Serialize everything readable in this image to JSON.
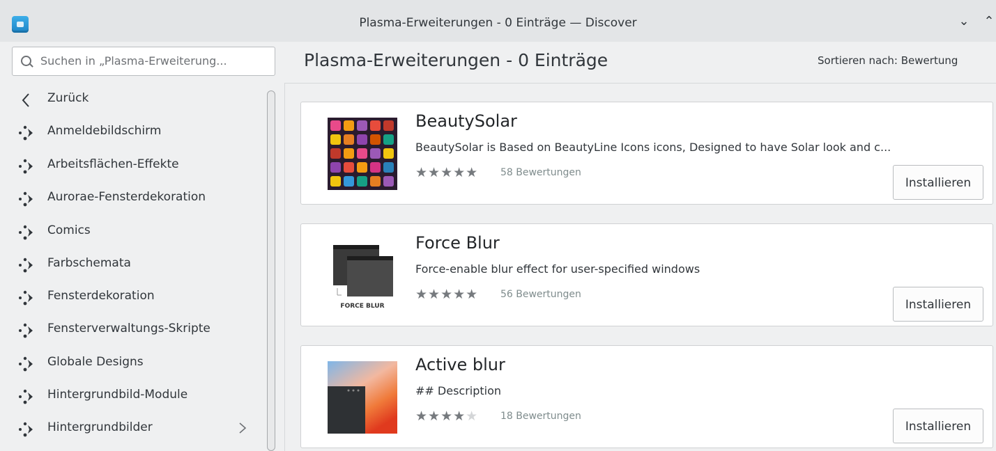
{
  "window": {
    "title": "Plasma-Erweiterungen - 0 Einträge — Discover",
    "min_icon": "chevron-down-icon",
    "max_icon": "chevron-up-icon"
  },
  "search": {
    "placeholder": "Suchen in „Plasma-Erweiterung..."
  },
  "header": {
    "title": "Plasma-Erweiterungen - 0 Einträge",
    "sort_label": "Sortieren nach: Bewertung"
  },
  "sidebar": {
    "items": [
      {
        "label": "Zurück",
        "icon": "back-arrow-icon"
      },
      {
        "label": "Anmeldebildschirm",
        "icon": "plasma-icon"
      },
      {
        "label": "Arbeitsflächen-Effekte",
        "icon": "plasma-icon"
      },
      {
        "label": "Aurorae-Fensterdekoration",
        "icon": "plasma-icon"
      },
      {
        "label": "Comics",
        "icon": "plasma-icon"
      },
      {
        "label": "Farbschemata",
        "icon": "plasma-icon"
      },
      {
        "label": "Fensterdekoration",
        "icon": "plasma-icon"
      },
      {
        "label": "Fensterverwaltungs-Skripte",
        "icon": "plasma-icon"
      },
      {
        "label": "Globale Designs",
        "icon": "plasma-icon"
      },
      {
        "label": "Hintergrundbild-Module",
        "icon": "plasma-icon"
      },
      {
        "label": "Hintergrundbilder",
        "icon": "plasma-icon",
        "has_children": true
      }
    ]
  },
  "results": [
    {
      "title": "BeautySolar",
      "description": "BeautySolar is Based on BeautyLine Icons icons, Designed to have Solar look and c...",
      "rating": 5,
      "rating_count": "58 Bewertungen",
      "button": "Installieren"
    },
    {
      "title": "Force Blur",
      "description": "Force-enable blur effect for user-specified windows",
      "rating": 5,
      "rating_count": "56 Bewertungen",
      "button": "Installieren",
      "thumb_caption": "FORCE BLUR"
    },
    {
      "title": "Active blur",
      "description": "## Description",
      "rating": 4,
      "rating_count": "18 Bewertungen",
      "button": "Installieren"
    }
  ],
  "colors": {
    "accent": "#3daee9",
    "window_bg": "#eff0f1",
    "titlebar_bg": "#e3e5e7"
  }
}
